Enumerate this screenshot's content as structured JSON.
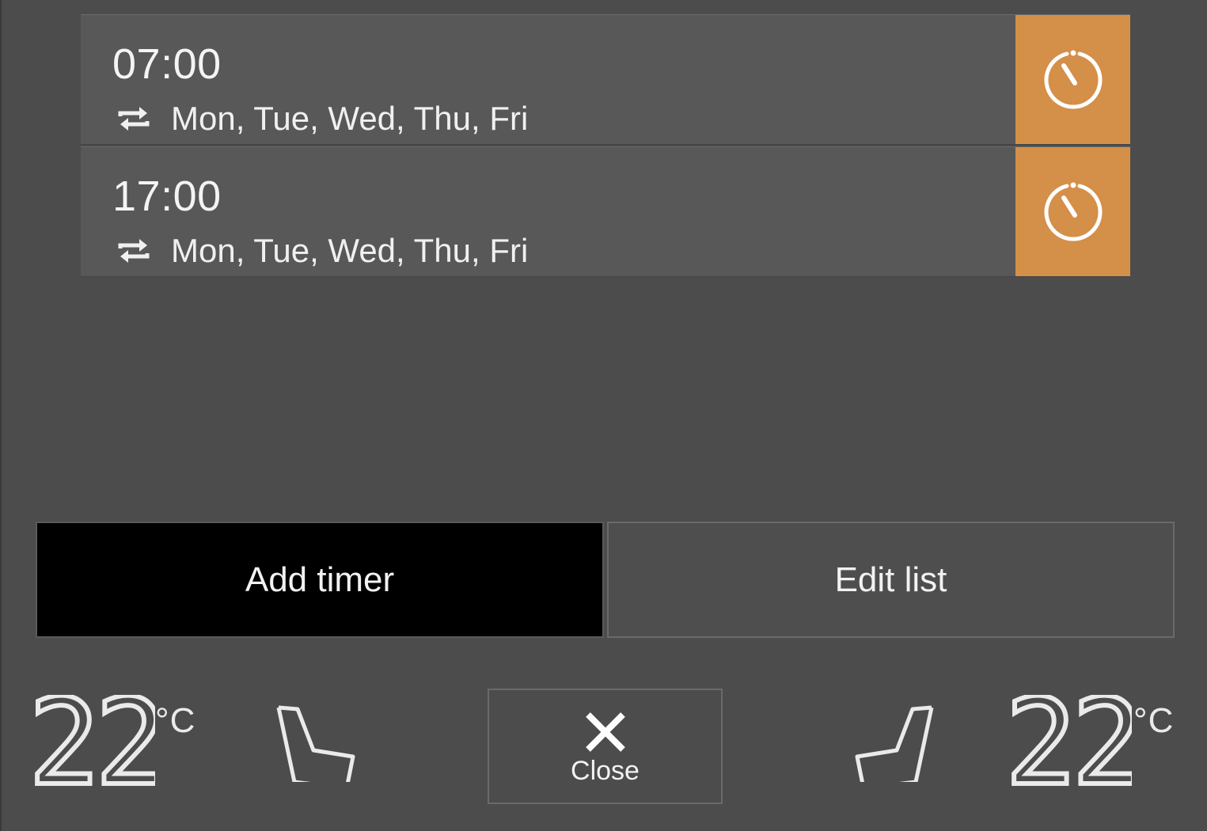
{
  "timers": [
    {
      "time": "07:00",
      "days": "Mon, Tue, Wed, Thu, Fri",
      "icon": "timer-icon"
    },
    {
      "time": "17:00",
      "days": "Mon, Tue, Wed, Thu, Fri",
      "icon": "timer-icon"
    }
  ],
  "actions": {
    "add_timer": "Add timer",
    "edit_list": "Edit list"
  },
  "climate": {
    "left_temp": "22",
    "left_unit": "°C",
    "right_temp": "22",
    "right_unit": "°C",
    "close_label": "Close"
  },
  "colors": {
    "background": "#4c4c4c",
    "row": "#585858",
    "accent": "#d48f48",
    "primary_button": "#000000"
  }
}
